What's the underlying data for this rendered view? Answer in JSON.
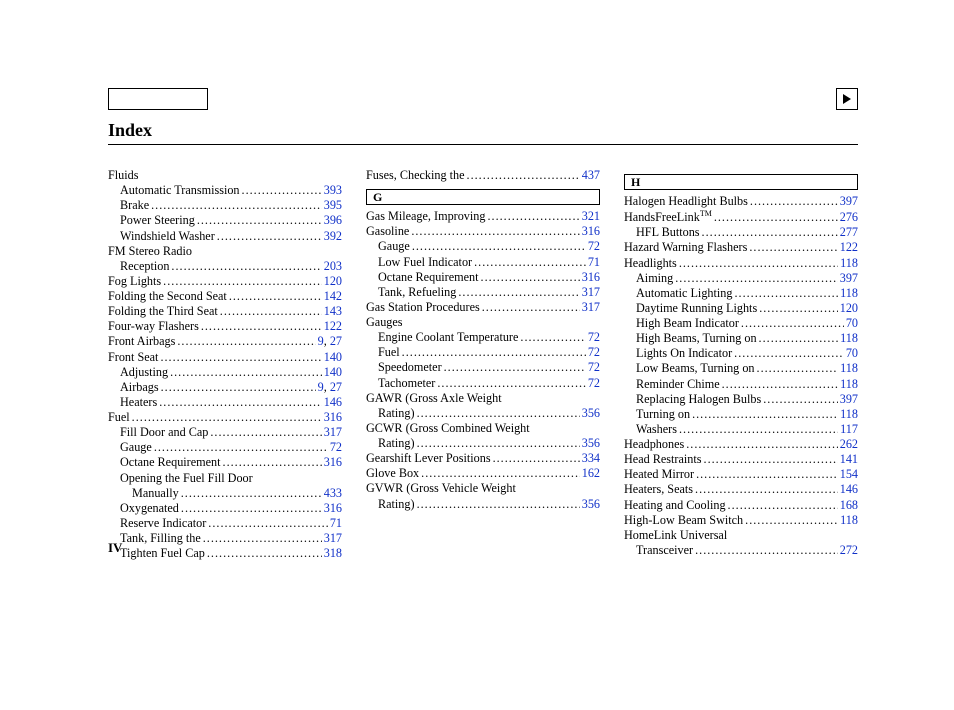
{
  "title": "Index",
  "page_label": "IV",
  "sections": {
    "G": "G",
    "H": "H"
  },
  "col1": [
    {
      "label": "Fluids",
      "page": "",
      "indent": 0,
      "nopage": true
    },
    {
      "label": "Automatic Transmission",
      "page": "393",
      "indent": 1
    },
    {
      "label": "Brake",
      "page": "395",
      "indent": 1
    },
    {
      "label": "Power Steering",
      "page": "396",
      "indent": 1
    },
    {
      "label": "Windshield Washer",
      "page": "392",
      "indent": 1
    },
    {
      "label": "FM Stereo Radio",
      "page": "",
      "indent": 0,
      "nopage": true
    },
    {
      "label": "Reception",
      "page": "203",
      "indent": 1
    },
    {
      "label": "Fog Lights",
      "page": "120",
      "indent": 0
    },
    {
      "label": "Folding the Second Seat",
      "page": "142",
      "indent": 0
    },
    {
      "label": "Folding the Third Seat",
      "page": "143",
      "indent": 0
    },
    {
      "label": "Four-way Flashers",
      "page": "122",
      "indent": 0
    },
    {
      "label": "Front Airbags",
      "page": "9, 27",
      "indent": 0,
      "multi": true
    },
    {
      "label": "Front Seat",
      "page": "140",
      "indent": 0
    },
    {
      "label": "Adjusting",
      "page": "140",
      "indent": 1
    },
    {
      "label": "Airbags",
      "page": "9, 27",
      "indent": 1,
      "multi": true
    },
    {
      "label": "Heaters",
      "page": "146",
      "indent": 1
    },
    {
      "label": "Fuel",
      "page": "316",
      "indent": 0
    },
    {
      "label": "Fill Door and Cap",
      "page": "317",
      "indent": 1
    },
    {
      "label": "Gauge",
      "page": "72",
      "indent": 1
    },
    {
      "label": "Octane Requirement",
      "page": "316",
      "indent": 1
    },
    {
      "label": "Opening the Fuel Fill Door",
      "page": "",
      "indent": 1,
      "nopage": true
    },
    {
      "label": "Manually",
      "page": "433",
      "indent": 2
    },
    {
      "label": "Oxygenated",
      "page": "316",
      "indent": 1
    },
    {
      "label": "Reserve Indicator",
      "page": "71",
      "indent": 1
    },
    {
      "label": "Tank, Filling the",
      "page": "317",
      "indent": 1
    },
    {
      "label": "Tighten Fuel Cap",
      "page": "318",
      "indent": 1
    }
  ],
  "col2_top": [
    {
      "label": "Fuses, Checking the",
      "page": "437",
      "indent": 0
    }
  ],
  "col2": [
    {
      "label": "Gas Mileage, Improving",
      "page": "321",
      "indent": 0
    },
    {
      "label": "Gasoline",
      "page": "316",
      "indent": 0
    },
    {
      "label": "Gauge",
      "page": "72",
      "indent": 1
    },
    {
      "label": "Low Fuel Indicator",
      "page": "71",
      "indent": 1
    },
    {
      "label": "Octane Requirement",
      "page": "316",
      "indent": 1
    },
    {
      "label": "Tank, Refueling",
      "page": "317",
      "indent": 1
    },
    {
      "label": "Gas Station Procedures",
      "page": "317",
      "indent": 0
    },
    {
      "label": "Gauges",
      "page": "",
      "indent": 0,
      "nopage": true
    },
    {
      "label": "Engine Coolant Temperature",
      "page": "72",
      "indent": 1
    },
    {
      "label": "Fuel",
      "page": "72",
      "indent": 1
    },
    {
      "label": "Speedometer",
      "page": "72",
      "indent": 1
    },
    {
      "label": "Tachometer",
      "page": "72",
      "indent": 1
    },
    {
      "label": "GAWR (Gross Axle Weight",
      "page": "",
      "indent": 0,
      "nopage": true
    },
    {
      "label": "Rating)",
      "page": "356",
      "indent": 1
    },
    {
      "label": "GCWR (Gross Combined Weight",
      "page": "",
      "indent": 0,
      "nopage": true
    },
    {
      "label": "Rating)",
      "page": "356",
      "indent": 1
    },
    {
      "label": "Gearshift Lever Positions",
      "page": "334",
      "indent": 0
    },
    {
      "label": "Glove Box",
      "page": "162",
      "indent": 0
    },
    {
      "label": "GVWR (Gross Vehicle Weight",
      "page": "",
      "indent": 0,
      "nopage": true
    },
    {
      "label": "Rating)",
      "page": "356",
      "indent": 1
    }
  ],
  "col3": [
    {
      "label": "Halogen Headlight Bulbs",
      "page": "397",
      "indent": 0
    },
    {
      "label": "HandsFreeLink",
      "page": "276",
      "indent": 0,
      "tm": true
    },
    {
      "label": "HFL Buttons",
      "page": "277",
      "indent": 1
    },
    {
      "label": "Hazard Warning Flashers",
      "page": "122",
      "indent": 0
    },
    {
      "label": "Headlights",
      "page": "118",
      "indent": 0
    },
    {
      "label": "Aiming",
      "page": "397",
      "indent": 1
    },
    {
      "label": "Automatic Lighting",
      "page": "118",
      "indent": 1
    },
    {
      "label": "Daytime Running Lights",
      "page": "120",
      "indent": 1
    },
    {
      "label": "High Beam Indicator",
      "page": "70",
      "indent": 1
    },
    {
      "label": "High Beams, Turning on",
      "page": "118",
      "indent": 1
    },
    {
      "label": "Lights On Indicator",
      "page": "70",
      "indent": 1
    },
    {
      "label": "Low Beams, Turning on",
      "page": "118",
      "indent": 1
    },
    {
      "label": "Reminder Chime",
      "page": "118",
      "indent": 1
    },
    {
      "label": "Replacing Halogen Bulbs",
      "page": "397",
      "indent": 1
    },
    {
      "label": "Turning on",
      "page": "118",
      "indent": 1
    },
    {
      "label": "Washers",
      "page": "117",
      "indent": 1
    },
    {
      "label": "Headphones",
      "page": "262",
      "indent": 0
    },
    {
      "label": "Head Restraints",
      "page": "141",
      "indent": 0
    },
    {
      "label": "Heated Mirror",
      "page": "154",
      "indent": 0
    },
    {
      "label": "Heaters, Seats",
      "page": "146",
      "indent": 0
    },
    {
      "label": "Heating and Cooling",
      "page": "168",
      "indent": 0
    },
    {
      "label": "High-Low Beam Switch",
      "page": "118",
      "indent": 0
    },
    {
      "label": "HomeLink Universal",
      "page": "",
      "indent": 0,
      "nopage": true
    },
    {
      "label": "Transceiver",
      "page": "272",
      "indent": 1
    }
  ]
}
